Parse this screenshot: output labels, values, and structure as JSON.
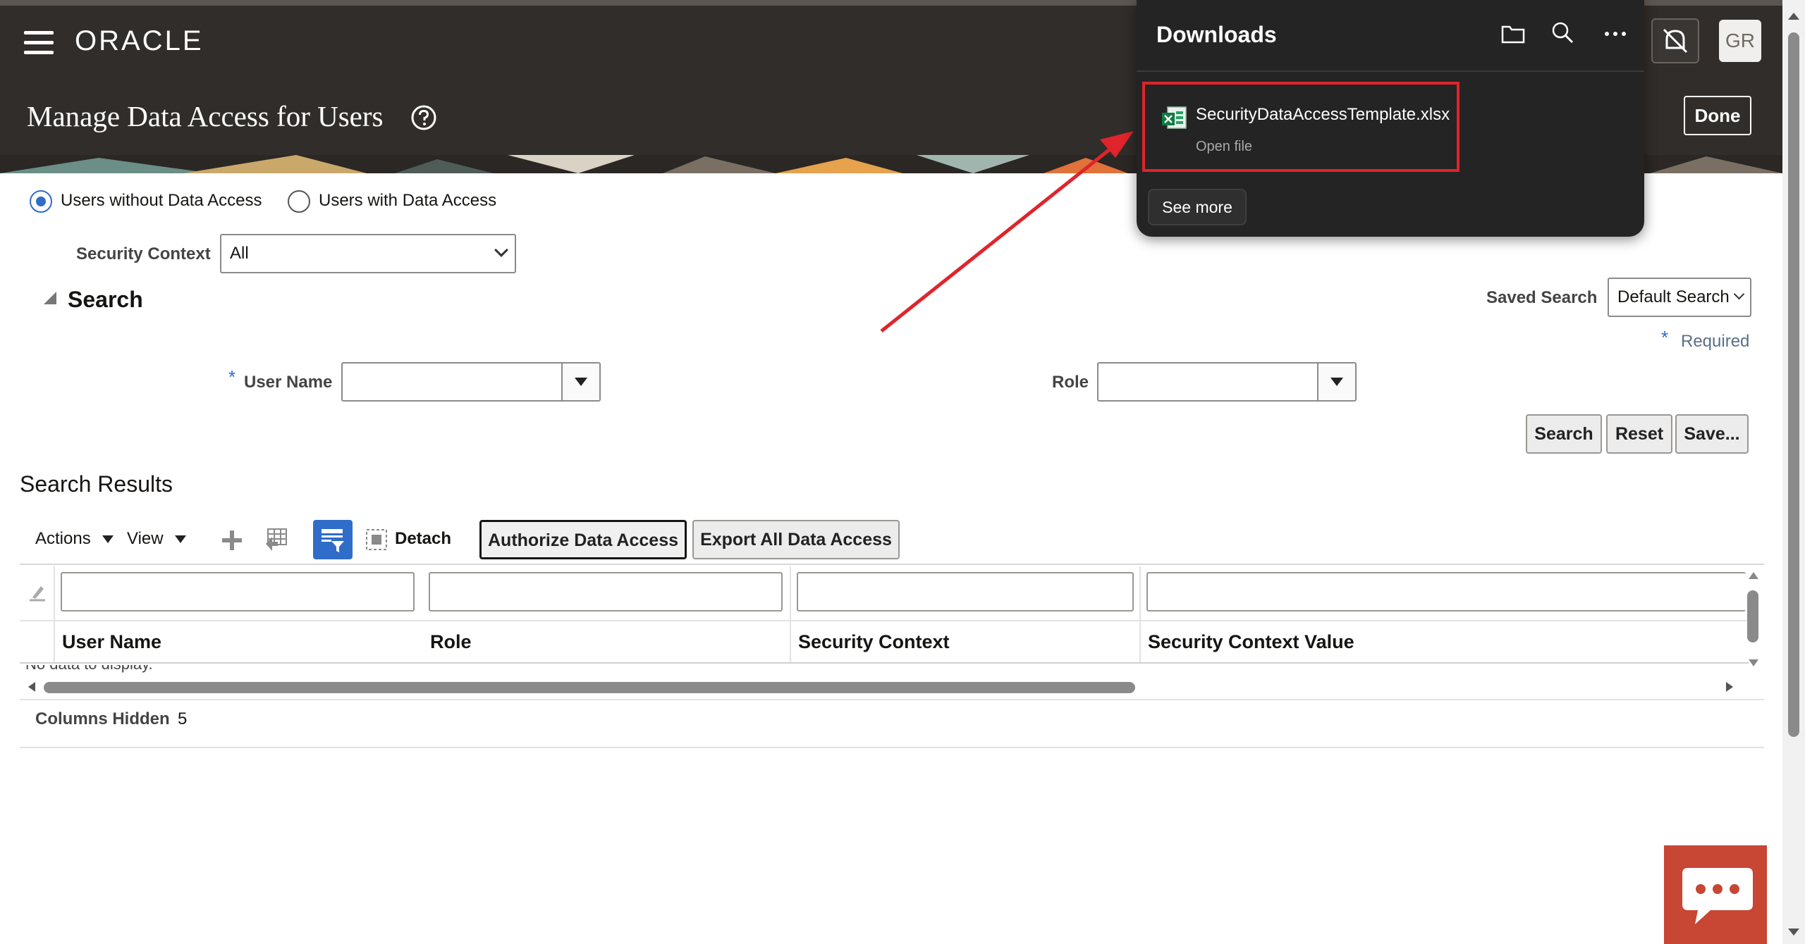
{
  "app": {
    "brand": "ORACLE",
    "page_title": "Manage Data Access for Users",
    "avatar_initials": "GR",
    "done_label": "Done"
  },
  "filters": {
    "radio_options": [
      "Users without Data Access",
      "Users with Data Access"
    ],
    "selected_radio": "Users without Data Access",
    "security_context_label": "Security Context",
    "security_context_value": "All"
  },
  "search": {
    "heading": "Search",
    "saved_search_label": "Saved Search",
    "saved_search_value": "Default Search",
    "required_marker": "*",
    "required_label": "Required",
    "user_name_label": "User Name",
    "role_label": "Role",
    "buttons": {
      "search": "Search",
      "reset": "Reset",
      "save": "Save..."
    }
  },
  "results": {
    "heading": "Search Results",
    "toolbar": {
      "actions": "Actions",
      "view": "View",
      "detach": "Detach",
      "authorize": "Authorize Data Access",
      "export": "Export All Data Access"
    },
    "columns": [
      "User Name",
      "Role",
      "Security Context",
      "Security Context Value"
    ],
    "no_data_partial": "No data to display.",
    "columns_hidden_label": "Columns Hidden",
    "columns_hidden_count": "5"
  },
  "downloads": {
    "title": "Downloads",
    "file_name": "SecurityDataAccessTemplate.xlsx",
    "open_file": "Open file",
    "see_more": "See more"
  },
  "colors": {
    "header_bg": "#312d2a",
    "accent_blue": "#2f6dc9",
    "highlight_red": "#e0242b",
    "chat_red": "#c74634"
  }
}
